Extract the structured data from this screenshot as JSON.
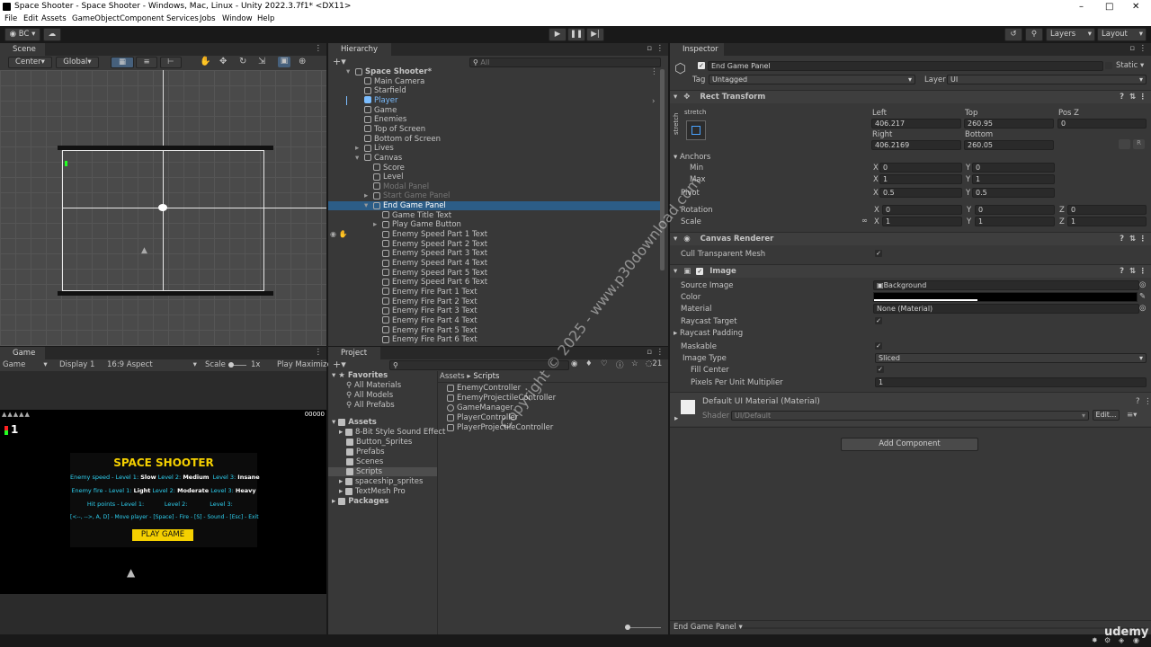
{
  "window": {
    "title": "Space Shooter - Space Shooter - Windows, Mac, Linux - Unity 2022.3.7f1* <DX11>"
  },
  "menu": [
    "File",
    "Edit",
    "Assets",
    "GameObject",
    "Component",
    "Services",
    "Jobs",
    "Window",
    "Help"
  ],
  "toolbar": {
    "account": "BC",
    "layers": "Layers",
    "layout": "Layout"
  },
  "scene": {
    "tab": "Scene",
    "pivot": "Center",
    "space": "Global"
  },
  "game": {
    "tab": "Game",
    "mode": "Game",
    "display": "Display 1",
    "aspect": "16:9 Aspect",
    "scale_label": "Scale",
    "scale_value": "1x",
    "play_mode": "Play Maximize",
    "score": "00000",
    "lives": "1",
    "panel": {
      "title": "SPACE SHOOTER",
      "line1": {
        "a": "Enemy speed - Level 1:",
        "b": "Slow",
        "c": "Level 2:",
        "d": "Medium",
        "e": "Level 3:",
        "f": "Insane"
      },
      "line2": {
        "a": "Enemy fire - Level 1:",
        "b": "Light",
        "c": "Level 2:",
        "d": "Moderate",
        "e": "Level 3:",
        "f": "Heavy"
      },
      "line3": {
        "a": "Hit points - Level 1:",
        "c": "Level 2:",
        "e": "Level 3:"
      },
      "line4": "[<--, -->, A, D] - Move player - [Space] - Fire - [S] - Sound - [Esc] - Exit",
      "button": "PLAY GAME"
    }
  },
  "hierarchy": {
    "tab": "Hierarchy",
    "search_placeholder": "All",
    "items": [
      {
        "label": "Space Shooter*",
        "indent": 0,
        "style": "root"
      },
      {
        "label": "Main Camera",
        "indent": 1
      },
      {
        "label": "Starfield",
        "indent": 1
      },
      {
        "label": "Player",
        "indent": 1,
        "style": "prefab"
      },
      {
        "label": "Game",
        "indent": 1
      },
      {
        "label": "Enemies",
        "indent": 1
      },
      {
        "label": "Top of Screen",
        "indent": 1
      },
      {
        "label": "Bottom of Screen",
        "indent": 1
      },
      {
        "label": "Lives",
        "indent": 1
      },
      {
        "label": "Canvas",
        "indent": 1
      },
      {
        "label": "Score",
        "indent": 2
      },
      {
        "label": "Level",
        "indent": 2
      },
      {
        "label": "Modal Panel",
        "indent": 2,
        "style": "disabled"
      },
      {
        "label": "Start Game Panel",
        "indent": 2,
        "style": "disabled"
      },
      {
        "label": "End Game Panel",
        "indent": 2,
        "style": "selected"
      },
      {
        "label": "Game Title Text",
        "indent": 3
      },
      {
        "label": "Play Game Button",
        "indent": 3
      },
      {
        "label": "Enemy Speed Part 1 Text",
        "indent": 3
      },
      {
        "label": "Enemy Speed Part 2 Text",
        "indent": 3
      },
      {
        "label": "Enemy Speed Part 3 Text",
        "indent": 3
      },
      {
        "label": "Enemy Speed Part 4 Text",
        "indent": 3
      },
      {
        "label": "Enemy Speed Part 5 Text",
        "indent": 3
      },
      {
        "label": "Enemy Speed Part 6 Text",
        "indent": 3
      },
      {
        "label": "Enemy Fire Part 1 Text",
        "indent": 3
      },
      {
        "label": "Enemy Fire Part 2 Text",
        "indent": 3
      },
      {
        "label": "Enemy Fire Part 3 Text",
        "indent": 3
      },
      {
        "label": "Enemy Fire Part 4 Text",
        "indent": 3
      },
      {
        "label": "Enemy Fire Part 5 Text",
        "indent": 3
      },
      {
        "label": "Enemy Fire Part 6 Text",
        "indent": 3
      }
    ]
  },
  "project": {
    "tab": "Project",
    "hidden_count": "21",
    "favorites": {
      "label": "Favorites",
      "items": [
        "All Materials",
        "All Models",
        "All Prefabs"
      ]
    },
    "assets": {
      "label": "Assets",
      "items": [
        "8-Bit Style Sound Effect",
        "Button_Sprites",
        "Prefabs",
        "Scenes",
        "Scripts",
        "spaceship_sprites",
        "TextMesh Pro"
      ]
    },
    "packages": "Packages",
    "breadcrumb": [
      "Assets",
      "Scripts"
    ],
    "files": [
      "EnemyController",
      "EnemyProjectileController",
      "GameManager",
      "PlayerController",
      "PlayerProjectileController"
    ]
  },
  "inspector": {
    "tab": "Inspector",
    "object_name": "End Game Panel",
    "static_label": "Static",
    "tag_label": "Tag",
    "tag": "Untagged",
    "layer_label": "Layer",
    "layer": "UI",
    "rect": {
      "header": "Rect Transform",
      "stretch": "stretch",
      "left_label": "Left",
      "left": "406.217",
      "top_label": "Top",
      "top": "260.95",
      "posz_label": "Pos Z",
      "posz": "0",
      "right_label": "Right",
      "right": "406.2169",
      "bottom_label": "Bottom",
      "bottom": "260.05",
      "anchors": "Anchors",
      "min": "Min",
      "min_x": "0",
      "min_y": "0",
      "max": "Max",
      "max_x": "1",
      "max_y": "1",
      "pivot": "Pivot",
      "pivot_x": "0.5",
      "pivot_y": "0.5",
      "rotation": "Rotation",
      "rot_x": "0",
      "rot_y": "0",
      "rot_z": "0",
      "scale": "Scale",
      "scale_x": "1",
      "scale_y": "1",
      "scale_z": "1"
    },
    "canvas_renderer": {
      "header": "Canvas Renderer",
      "cull": "Cull Transparent Mesh"
    },
    "image": {
      "header": "Image",
      "source_label": "Source Image",
      "source": "Background",
      "color_label": "Color",
      "material_label": "Material",
      "material": "None (Material)",
      "raycast_target": "Raycast Target",
      "raycast_padding": "Raycast Padding",
      "maskable": "Maskable",
      "image_type_label": "Image Type",
      "image_type": "Sliced",
      "fill_center": "Fill Center",
      "ppu_label": "Pixels Per Unit Multiplier",
      "ppu": "1"
    },
    "material": {
      "name": "Default UI Material (Material)",
      "shader_label": "Shader",
      "shader": "UI/Default",
      "edit": "Edit..."
    },
    "add_component": "Add Component",
    "footer": "End Game Panel"
  },
  "watermark": "Copyright © 2025 - www.p30download.com",
  "brand": "udemy",
  "colors": {
    "selected": "#2c5d87",
    "prefab": "#7bbdff",
    "title_yellow": "#f5d000",
    "cyan_text": "#2ed0f0"
  }
}
